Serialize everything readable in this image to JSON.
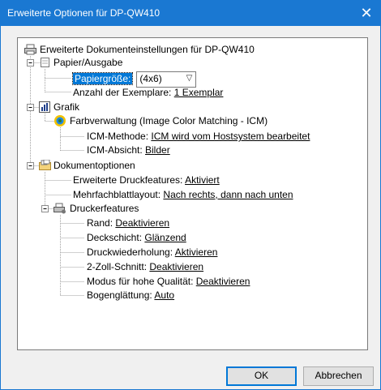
{
  "window": {
    "title": "Erweiterte Optionen für DP-QW410",
    "close": "✕"
  },
  "tree": {
    "root": "Erweiterte Dokumenteinstellungen für DP-QW410",
    "papier": {
      "label": "Papier/Ausgabe",
      "papiergroesse_label": "Papiergröße:",
      "papiergroesse_value": "(4x6)",
      "anzahl_label": "Anzahl der Exemplare: ",
      "anzahl_value": "1 Exemplar"
    },
    "grafik": {
      "label": "Grafik",
      "farb_label": "Farbverwaltung (Image Color Matching - ICM)",
      "icm_methode_label": "ICM-Methode: ",
      "icm_methode_value": "ICM wird vom Hostsystem bearbeitet",
      "icm_absicht_label": "ICM-Absicht: ",
      "icm_absicht_value": "Bilder"
    },
    "dokument": {
      "label": "Dokumentoptionen",
      "erw_label": "Erweiterte Druckfeatures: ",
      "erw_value": "Aktiviert",
      "mehrfach_label": "Mehrfachblattlayout: ",
      "mehrfach_value": "Nach rechts, dann nach unten",
      "drucker_label": "Druckerfeatures",
      "rand_label": "Rand: ",
      "rand_value": "Deaktivieren",
      "deck_label": "Deckschicht: ",
      "deck_value": "Glänzend",
      "wdh_label": "Druckwiederholung: ",
      "wdh_value": "Aktivieren",
      "zoll_label": "2-Zoll-Schnitt: ",
      "zoll_value": "Deaktivieren",
      "modus_label": "Modus für hohe Qualität: ",
      "modus_value": "Deaktivieren",
      "bogen_label": "Bogenglättung: ",
      "bogen_value": "Auto"
    }
  },
  "buttons": {
    "ok": "OK",
    "cancel": "Abbrechen"
  }
}
